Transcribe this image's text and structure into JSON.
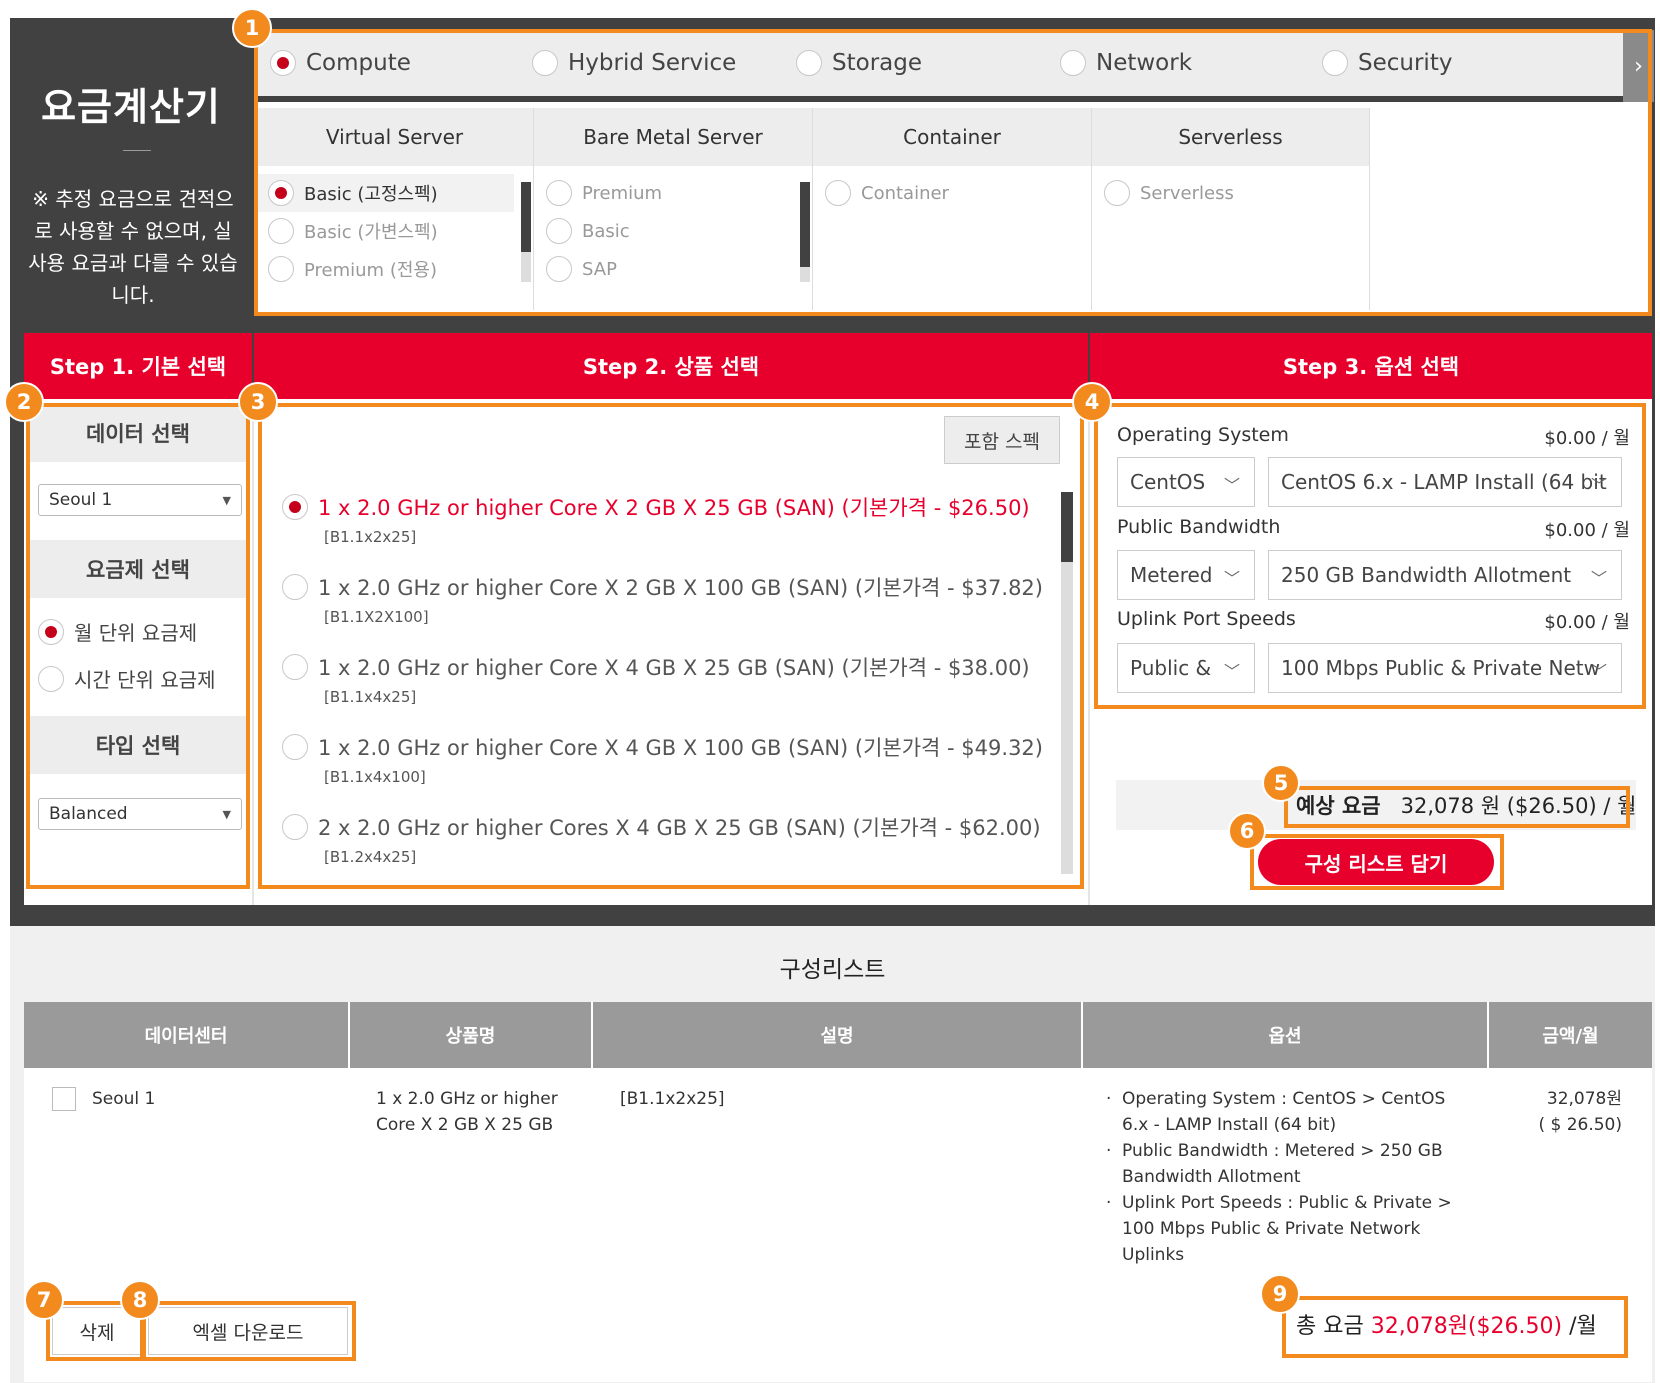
{
  "left_panel": {
    "title": "요금계산기",
    "notice": "※ 추정 요금으로 견적으로 사용할 수 없으며, 실 사용 요금과 다를 수 있습니다."
  },
  "categories": [
    "Compute",
    "Hybrid Service",
    "Storage",
    "Network",
    "Security"
  ],
  "selected_category": "Compute",
  "next_icon": "chevron-right-icon",
  "sub_categories": [
    {
      "label": "Virtual Server",
      "items": [
        "Basic (고정스펙)",
        "Basic (가변스펙)",
        "Premium (전용)"
      ],
      "selected": 0
    },
    {
      "label": "Bare Metal Server",
      "items": [
        "Premium",
        "Basic",
        "SAP"
      ],
      "selected": -1
    },
    {
      "label": "Container",
      "items": [
        "Container"
      ],
      "selected": -1
    },
    {
      "label": "Serverless",
      "items": [
        "Serverless"
      ],
      "selected": -1
    }
  ],
  "steps": {
    "step1": "Step 1. 기본 선택",
    "step2": "Step 2. 상품 선택",
    "step3": "Step 3. 옵션 선택"
  },
  "step1": {
    "data_label": "데이터 선택",
    "data_value": "Seoul 1",
    "plan_label": "요금제 선택",
    "plan_options": [
      "월 단위 요금제",
      "시간 단위 요금제"
    ],
    "plan_selected": 0,
    "type_label": "타입 선택",
    "type_value": "Balanced"
  },
  "step2": {
    "spec_button": "포함 스펙",
    "products": [
      {
        "name": "1 x 2.0 GHz or higher Core X 2 GB X 25 GB (SAN) (기본가격 - $26.50)",
        "code": "[B1.1x2x25]"
      },
      {
        "name": "1 x 2.0 GHz or higher Core X 2 GB X 100 GB (SAN) (기본가격 - $37.82)",
        "code": "[B1.1X2X100]"
      },
      {
        "name": "1 x 2.0 GHz or higher Core X 4 GB X 25 GB (SAN) (기본가격 - $38.00)",
        "code": "[B1.1x4x25]"
      },
      {
        "name": "1 x 2.0 GHz or higher Core X 4 GB X 100 GB (SAN) (기본가격 - $49.32)",
        "code": "[B1.1x4x100]"
      },
      {
        "name": "2 x 2.0 GHz or higher Cores X 4 GB X 25 GB (SAN) (기본가격 - $62.00)",
        "code": "[B1.2x4x25]"
      }
    ],
    "selected": 0
  },
  "step3": {
    "options": [
      {
        "label": "Operating System",
        "price": "$0.00 / 월",
        "select1": "CentOS",
        "select2": "CentOS 6.x - LAMP Install (64 bit"
      },
      {
        "label": "Public Bandwidth",
        "price": "$0.00 / 월",
        "select1": "Metered",
        "select2": "250 GB Bandwidth Allotment"
      },
      {
        "label": "Uplink Port Speeds",
        "price": "$0.00 / 월",
        "select1": "Public &",
        "select2": "100 Mbps Public & Private Netw"
      }
    ],
    "estimate_label": "예상 요금",
    "estimate_value": "32,078 원 ($26.50) / 월",
    "add_button": "구성 리스트 담기"
  },
  "config_list": {
    "title": "구성리스트",
    "headers": [
      "데이터센터",
      "상품명",
      "설명",
      "옵션",
      "금액/월"
    ],
    "row": {
      "datacenter": "Seoul 1",
      "product": "1 x 2.0 GHz or higher Core X 2 GB X 25 GB",
      "description": "[B1.1x2x25]",
      "options": [
        "Operating System : CentOS > CentOS 6.x - LAMP Install (64 bit)",
        "Public Bandwidth : Metered > 250 GB Bandwidth Allotment",
        "Uplink Port Speeds : Public & Private > 100 Mbps Public & Private Network Uplinks"
      ],
      "amount_krw": "32,078원",
      "amount_usd": "( $ 26.50)"
    },
    "delete_button": "삭제",
    "excel_button": "엑셀 다운로드",
    "total_label": "총 요금",
    "total_value": "32,078원($26.50)",
    "total_suffix": "/월"
  },
  "markers": [
    "1",
    "2",
    "3",
    "4",
    "5",
    "6",
    "7",
    "8",
    "9"
  ],
  "colors": {
    "accent_red": "#e8002d",
    "annotation_orange": "#f28a1e",
    "dark_frame": "#414141"
  }
}
